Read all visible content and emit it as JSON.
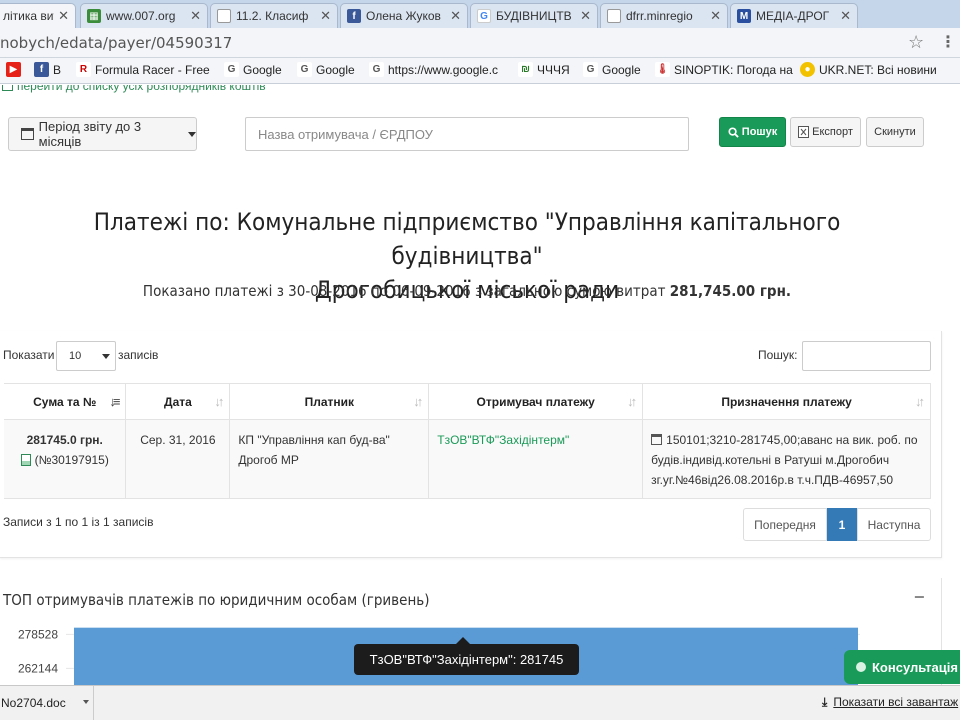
{
  "browser": {
    "tabs": [
      {
        "label": "літика вит",
        "icon": "page-icon",
        "active": true
      },
      {
        "label": "www.007.org",
        "icon": "site-icon"
      },
      {
        "label": "11.2. Класиф",
        "icon": "page-icon"
      },
      {
        "label": "Олена Жуков",
        "icon": "facebook-icon"
      },
      {
        "label": "БУДІВНИЦТВ",
        "icon": "google-icon"
      },
      {
        "label": "dfrr.minregio",
        "icon": "page-icon"
      },
      {
        "label": "МЕДІА-ДРОГ",
        "icon": "media-icon"
      }
    ],
    "url": "nobych/edata/payer/04590317",
    "bookmarks": [
      {
        "label": "",
        "icon": "youtube-icon"
      },
      {
        "label": "В",
        "icon": "facebook-icon"
      },
      {
        "label": "Formula Racer - Free",
        "icon": "racer-icon"
      },
      {
        "label": "Google",
        "icon": "google-icon"
      },
      {
        "label": "Google",
        "icon": "google-icon"
      },
      {
        "label": "https://www.google.c",
        "icon": "google-icon"
      },
      {
        "label": "ЧЧЧЯ",
        "icon": "chchchya-icon"
      },
      {
        "label": "Google",
        "icon": "google-icon"
      },
      {
        "label": "SINOPTIK: Погода на",
        "icon": "thermometer-icon"
      },
      {
        "label": "UKR.NET: Всі новини",
        "icon": "ukrnet-icon"
      }
    ]
  },
  "page": {
    "back_link": "перейти до списку усіх розпорядників коштів",
    "period_button": "Період звіту до 3 місяців",
    "search_placeholder": "Назва отримувача / ЄРДПОУ",
    "search_button": "Пошук",
    "export_button": "Експорт",
    "reset_button": "Скинути",
    "title_line1": "Платежі по: Комунальне підприємство \"Управління капітального будівництва\"",
    "title_line2": "Дрогобицької міської ради",
    "summary_text": "Показано платежі з 30-08-2016 по 06-09-2016 з загальною сумою витрат",
    "summary_total": "281,745.00 грн."
  },
  "table": {
    "show_label": "Показати",
    "page_size": "10",
    "records_label": "записів",
    "filter_label": "Пошук:",
    "columns": [
      "Сума та №",
      "Дата",
      "Платник",
      "Отримувач платежу",
      "Призначення платежу"
    ],
    "rows": [
      {
        "amount": "281745.0 грн.",
        "number": "(№30197915)",
        "date": "Сер. 31, 2016",
        "payer_line1": "КП \"Управління кап буд-ва\"",
        "payer_line2": "Дрогоб МР",
        "recipient": "ТзОВ\"ВТФ\"Західінтерм\"",
        "purpose_line1": "150101;3210-281745,00;аванс на вик. роб. по",
        "purpose_line2": "будів.індивід.котельні в Ратуші м.Дрогобич",
        "purpose_line3": "зг.уг.№46від26.08.2016р.в т.ч.ПДВ-46957,50"
      }
    ],
    "info": "Записи з 1 по 1 із 1 записів",
    "pagination": {
      "prev": "Попередня",
      "current": "1",
      "next": "Наступна"
    }
  },
  "chart_data": {
    "type": "bar",
    "title": "ТОП отримувачів платежів по юридичним особам (гривень)",
    "categories": [
      "ТзОВ\"ВТФ\"Західінтерм\""
    ],
    "values": [
      281745
    ],
    "y_ticks": [
      278528,
      262144
    ],
    "ylim": [
      257000,
      284000
    ],
    "bar_color": "#5b9bd5",
    "tooltip": "ТзОВ\"ВТФ\"Західінтерм\": 281745"
  },
  "consult_button": "Консультація",
  "downloads": {
    "file": "No2704.doc",
    "show_all": "Показати всі завантаж"
  },
  "colors": {
    "accent_green": "#1a9a58",
    "link_green": "#2e8b57",
    "pagination_blue": "#337ab7"
  }
}
